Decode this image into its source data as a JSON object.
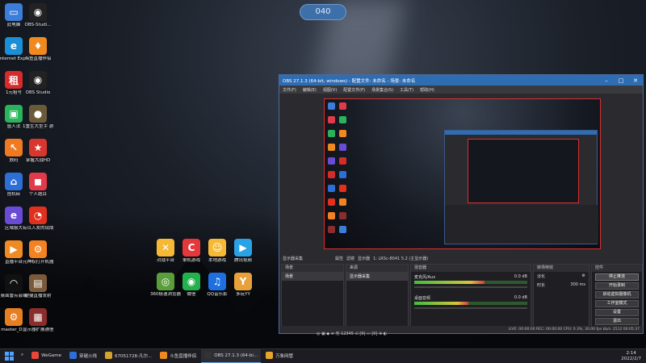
{
  "top_badge": "040",
  "desktop_icons": [
    {
      "label": "此电脑",
      "color": "#3b7dd8",
      "glyph": "▭"
    },
    {
      "label": "OBS-Studi...",
      "color": "#222",
      "glyph": "◉"
    },
    {
      "label": "Internet Explorer",
      "color": "#1a8fd6",
      "glyph": "e"
    },
    {
      "label": "斗鱼直播伴侣",
      "color": "#f08a1e",
      "glyph": "♦"
    },
    {
      "label": "1元租号",
      "color": "#d62b2b",
      "glyph": "租"
    },
    {
      "label": "OBS Studio",
      "color": "#222",
      "glyph": "◉"
    },
    {
      "label": "盛人法",
      "color": "#29b35a",
      "glyph": "▣"
    },
    {
      "label": "1重生大型手 游服",
      "color": "#6b5a3a",
      "glyph": "●"
    },
    {
      "label": "放码",
      "color": "#f07a22",
      "glyph": "↖"
    },
    {
      "label": "掌握大战HD",
      "color": "#d8362f",
      "glyph": "★"
    },
    {
      "label": "挂机砖",
      "color": "#2c6fd6",
      "glyph": "⌂"
    },
    {
      "label": "个人题目",
      "color": "#e13a4a",
      "glyph": "◼"
    },
    {
      "label": "区域服大",
      "color": "#6a4bd6",
      "glyph": "e"
    },
    {
      "label": "有以入发的现成",
      "color": "#e0301e",
      "glyph": "◔"
    },
    {
      "label": "直播平台",
      "color": "#f08a22",
      "glyph": "▶"
    },
    {
      "label": "元神权打开机器",
      "color": "#f58220",
      "glyph": "⚙"
    },
    {
      "label": "桌面雷点会编",
      "color": "#111",
      "glyph": "◠"
    },
    {
      "label": "便捷直播发射",
      "color": "#7a5a3a",
      "glyph": "▤"
    },
    {
      "label": "master_D...",
      "color": "#e67e22",
      "glyph": "⚙"
    },
    {
      "label": "显示器扩展通信工具",
      "color": "#8a2d2d",
      "glyph": "▦"
    }
  ],
  "center_icons": [
    {
      "label": "对战平台",
      "color": "#f5b935",
      "glyph": "✕"
    },
    {
      "label": "单机游戏",
      "color": "#e5383b",
      "glyph": "C"
    },
    {
      "label": "本地游戏",
      "color": "#f5b935",
      "glyph": "☺"
    },
    {
      "label": "腾讯视频",
      "color": "#2aa3e6",
      "glyph": "▶"
    },
    {
      "label": "360极速浏览器",
      "color": "#5a9e3a",
      "glyph": "◎"
    },
    {
      "label": "微信",
      "color": "#22b14c",
      "glyph": "◉"
    },
    {
      "label": "QQ音乐影",
      "color": "#1e6fe0",
      "glyph": "♫"
    },
    {
      "label": "多玩YY",
      "color": "#e8a13a",
      "glyph": "Y"
    }
  ],
  "obs": {
    "title": "OBS 27.1.3 (64-bit, windows) - 配置文件: 未命名 - 场景: 未命名",
    "menu": [
      "文件(F)",
      "编辑(E)",
      "视图(V)",
      "配置文件(P)",
      "场景集合(S)",
      "工具(T)",
      "帮助(H)"
    ],
    "dock_head": [
      "显示器采集",
      "属性",
      "滤镜",
      "显示器",
      "1: LRSc-8041 5.2 (主显示器)"
    ],
    "scenes_header": "场景",
    "scenes": [
      "场景"
    ],
    "sources_header": "来源",
    "sources": [
      "显示器采集"
    ],
    "mixer_header": "混音器",
    "mixer": [
      {
        "name": "麦克风/Aux",
        "db": "0.0 dB",
        "level": 0.62
      },
      {
        "name": "桌面音频",
        "db": "0.0 dB",
        "level": 0.48
      }
    ],
    "transitions_header": "转场特效",
    "transition_type": "淡化",
    "duration_label": "时长",
    "duration_value": "300 ms",
    "controls_header": "控件",
    "controls": [
      "停止推流",
      "开始录制",
      "启动虚拟摄像机",
      "工作室模式",
      "设置",
      "退出"
    ],
    "status": "LIVE: 00:00:00   REC: 00:00:00   CPU: 0.3%, 30.00 fps   kb/s: 2512   00:05:37"
  },
  "tray_strip": "◎  ▣  ◆  ≡  无 12345  ⊙  [9]  ▭ [0]  ⊛  ◐",
  "taskbar": {
    "items": [
      {
        "label": "WeGame",
        "color": "#e8473a",
        "active": false
      },
      {
        "label": "穿越火线",
        "color": "#2c6fd6",
        "active": false
      },
      {
        "label": "67051728-凡尔...",
        "color": "#d4a32b",
        "active": false
      },
      {
        "label": "斗鱼直播伴侣",
        "color": "#f08a1e",
        "active": false
      },
      {
        "label": "OBS 27.1.3 (64-bi...",
        "color": "#333",
        "active": true
      },
      {
        "label": "万象网管",
        "color": "#e6a52b",
        "active": false
      }
    ],
    "time": "2:14",
    "date": "2022/2/7"
  }
}
